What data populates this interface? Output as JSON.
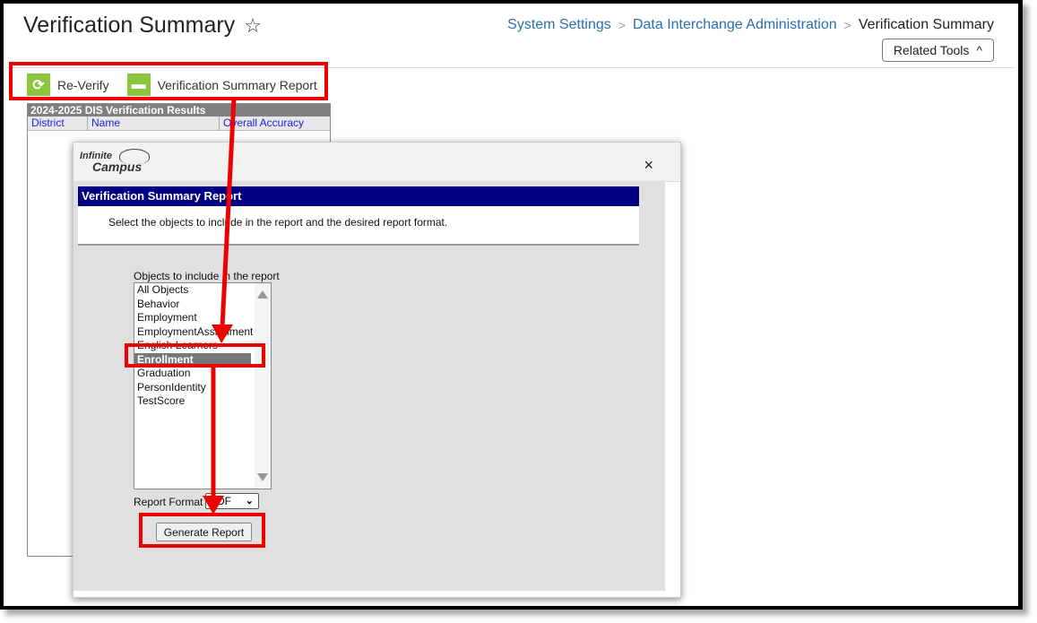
{
  "header": {
    "title": "Verification Summary",
    "favorite_icon": "star-outline-icon",
    "breadcrumb": [
      "System Settings",
      "Data Interchange Administration",
      "Verification Summary"
    ],
    "related_tools_label": "Related Tools"
  },
  "toolbar": {
    "reverify_label": "Re-Verify",
    "report_label": "Verification Summary Report"
  },
  "results": {
    "title": "2024-2025 DIS Verification Results",
    "columns": [
      "District",
      "Name",
      "Overall Accuracy"
    ]
  },
  "modal": {
    "logo_line1": "Infinite",
    "logo_line2": "Campus",
    "close_label": "×",
    "report_title": "Verification Summary Report",
    "description": "Select the objects to include in the report and the desired report format.",
    "objects_label": "Objects to include in the report",
    "objects": [
      "All Objects",
      "Behavior",
      "Employment",
      "EmploymentAssignment",
      "English Learners",
      "Enrollment",
      "Graduation",
      "PersonIdentity",
      "TestScore"
    ],
    "selected_object": "Enrollment",
    "format_label": "Report Format",
    "format_value": "PDF",
    "generate_label": "Generate Report"
  },
  "colors": {
    "accent_green": "#8cc63f",
    "report_header_navy": "#000080",
    "highlight_red": "#e00000",
    "link_blue": "#2a6fb0"
  }
}
